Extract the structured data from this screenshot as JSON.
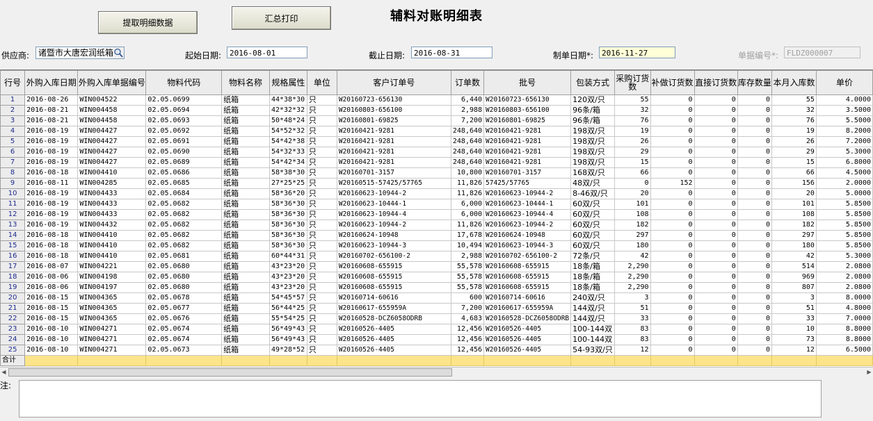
{
  "toolbar": {
    "fetch_label": "提取明细数据",
    "print_label": "汇总打印"
  },
  "title": "辅料对账明细表",
  "form": {
    "supplier_label": "供应商:",
    "supplier_value": "诸暨市大唐宏润纸箱",
    "start_label": "起始日期:",
    "start_value": "2016-08-01",
    "end_label": "截止日期:",
    "end_value": "2016-08-31",
    "created_label": "制单日期*:",
    "created_value": "2016-11-27",
    "docno_label": "单据编号*:",
    "docno_value": "FLDZ000007"
  },
  "grid": {
    "columns": [
      "行号",
      "外购入库日期",
      "外购入库单据编号",
      "物料代码",
      "物料名称",
      "规格属性",
      "单位",
      "客户订单号",
      "订单数",
      "批号",
      "包装方式",
      "采购订货数",
      "补做订货数",
      "直接订货数",
      "库存数量",
      "本月入库数",
      "单价"
    ],
    "rows": [
      [
        "1",
        "2016-08-26",
        "WIN004522",
        "02.05.0699",
        "纸箱",
        "44*38*30",
        "只",
        "W20160723-656130",
        "6,440",
        "W20160723-656130",
        "120双/只",
        "55",
        "0",
        "0",
        "0",
        "55",
        "4.0000"
      ],
      [
        "2",
        "2016-08-21",
        "WIN004458",
        "02.05.0694",
        "纸箱",
        "42*32*32",
        "只",
        "W20160803-656100",
        "2,988",
        "W20160803-656100",
        "96条/箱",
        "32",
        "0",
        "0",
        "0",
        "32",
        "3.5000"
      ],
      [
        "3",
        "2016-08-21",
        "WIN004458",
        "02.05.0693",
        "纸箱",
        "50*48*24",
        "只",
        "W20160801-69825",
        "7,200",
        "W20160801-69825",
        "96条/箱",
        "76",
        "0",
        "0",
        "0",
        "76",
        "5.5000"
      ],
      [
        "4",
        "2016-08-19",
        "WIN004427",
        "02.05.0692",
        "纸箱",
        "54*52*32",
        "只",
        "W20160421-9281",
        "248,640",
        "W20160421-9281",
        "198双/只",
        "19",
        "0",
        "0",
        "0",
        "19",
        "8.2000"
      ],
      [
        "5",
        "2016-08-19",
        "WIN004427",
        "02.05.0691",
        "纸箱",
        "54*42*38",
        "只",
        "W20160421-9281",
        "248,640",
        "W20160421-9281",
        "198双/只",
        "26",
        "0",
        "0",
        "0",
        "26",
        "7.2000"
      ],
      [
        "6",
        "2016-08-19",
        "WIN004427",
        "02.05.0690",
        "纸箱",
        "54*32*33",
        "只",
        "W20160421-9281",
        "248,640",
        "W20160421-9281",
        "198双/只",
        "29",
        "0",
        "0",
        "0",
        "29",
        "5.3000"
      ],
      [
        "7",
        "2016-08-19",
        "WIN004427",
        "02.05.0689",
        "纸箱",
        "54*42*34",
        "只",
        "W20160421-9281",
        "248,640",
        "W20160421-9281",
        "198双/只",
        "15",
        "0",
        "0",
        "0",
        "15",
        "6.8000"
      ],
      [
        "8",
        "2016-08-18",
        "WIN004410",
        "02.05.0686",
        "纸箱",
        "58*38*30",
        "只",
        "W20160701-3157",
        "10,800",
        "W20160701-3157",
        "168双/只",
        "66",
        "0",
        "0",
        "0",
        "66",
        "4.5000"
      ],
      [
        "9",
        "2016-08-11",
        "WIN004285",
        "02.05.0685",
        "纸箱",
        "27*25*25",
        "只",
        "W20160515-57425/57765",
        "11,826",
        "57425/57765",
        "48双/只",
        "0",
        "152",
        "0",
        "0",
        "156",
        "2.0000"
      ],
      [
        "10",
        "2016-08-19",
        "WIN004433",
        "02.05.0684",
        "纸箱",
        "58*36*20",
        "只",
        "W20160623-10944-2",
        "11,826",
        "W20160623-10944-2",
        "8-46双/只",
        "20",
        "0",
        "0",
        "0",
        "20",
        "5.0000"
      ],
      [
        "11",
        "2016-08-19",
        "WIN004433",
        "02.05.0682",
        "纸箱",
        "58*36*30",
        "只",
        "W20160623-10444-1",
        "6,000",
        "W20160623-10444-1",
        "60双/只",
        "101",
        "0",
        "0",
        "0",
        "101",
        "5.8500"
      ],
      [
        "12",
        "2016-08-19",
        "WIN004433",
        "02.05.0682",
        "纸箱",
        "58*36*30",
        "只",
        "W20160623-10944-4",
        "6,000",
        "W20160623-10944-4",
        "60双/只",
        "108",
        "0",
        "0",
        "0",
        "108",
        "5.8500"
      ],
      [
        "13",
        "2016-08-19",
        "WIN004432",
        "02.05.0682",
        "纸箱",
        "58*36*30",
        "只",
        "W20160623-10944-2",
        "11,826",
        "W20160623-10944-2",
        "60双/只",
        "182",
        "0",
        "0",
        "0",
        "182",
        "5.8500"
      ],
      [
        "14",
        "2016-08-18",
        "WIN004410",
        "02.05.0682",
        "纸箱",
        "58*36*30",
        "只",
        "W20160624-10948",
        "17,678",
        "W20160624-10948",
        "60双/只",
        "297",
        "0",
        "0",
        "0",
        "297",
        "5.8500"
      ],
      [
        "15",
        "2016-08-18",
        "WIN004410",
        "02.05.0682",
        "纸箱",
        "58*36*30",
        "只",
        "W20160623-10944-3",
        "10,494",
        "W20160623-10944-3",
        "60双/只",
        "180",
        "0",
        "0",
        "0",
        "180",
        "5.8500"
      ],
      [
        "16",
        "2016-08-18",
        "WIN004410",
        "02.05.0681",
        "纸箱",
        "60*44*31",
        "只",
        "W20160702-656100-2",
        "2,988",
        "W20160702-656100-2",
        "72条/只",
        "42",
        "0",
        "0",
        "0",
        "42",
        "5.3000"
      ],
      [
        "17",
        "2016-08-07",
        "WIN004221",
        "02.05.0680",
        "纸箱",
        "43*23*20",
        "只",
        "W20160608-655915",
        "55,578",
        "W20160608-655915",
        "18条/箱",
        "2,290",
        "0",
        "0",
        "0",
        "514",
        "2.0800"
      ],
      [
        "18",
        "2016-08-06",
        "WIN004198",
        "02.05.0680",
        "纸箱",
        "43*23*20",
        "只",
        "W20160608-655915",
        "55,578",
        "W20160608-655915",
        "18条/箱",
        "2,290",
        "0",
        "0",
        "0",
        "969",
        "2.0800"
      ],
      [
        "19",
        "2016-08-06",
        "WIN004197",
        "02.05.0680",
        "纸箱",
        "43*23*20",
        "只",
        "W20160608-655915",
        "55,578",
        "W20160608-655915",
        "18条/箱",
        "2,290",
        "0",
        "0",
        "0",
        "807",
        "2.0800"
      ],
      [
        "20",
        "2016-08-15",
        "WIN004365",
        "02.05.0678",
        "纸箱",
        "54*45*57",
        "只",
        "W20160714-60616",
        "600",
        "W20160714-60616",
        "240双/只",
        "3",
        "0",
        "0",
        "0",
        "3",
        "8.0000"
      ],
      [
        "21",
        "2016-08-15",
        "WIN004365",
        "02.05.0677",
        "纸箱",
        "56*44*25",
        "只",
        "W20160617-655959A",
        "7,200",
        "W20160617-655959A",
        "144双/只",
        "51",
        "0",
        "0",
        "0",
        "51",
        "4.8000"
      ],
      [
        "22",
        "2016-08-15",
        "WIN004365",
        "02.05.0676",
        "纸箱",
        "55*54*25",
        "只",
        "W20160528-DCZ6058ODRB",
        "4,683",
        "W20160528-DCZ6058ODRB",
        "144双/只",
        "33",
        "0",
        "0",
        "0",
        "33",
        "7.0000"
      ],
      [
        "23",
        "2016-08-10",
        "WIN004271",
        "02.05.0674",
        "纸箱",
        "56*49*43",
        "只",
        "W20160526-4405",
        "12,456",
        "W20160526-4405",
        "100-144双",
        "83",
        "0",
        "0",
        "0",
        "10",
        "8.8000"
      ],
      [
        "24",
        "2016-08-10",
        "WIN004271",
        "02.05.0674",
        "纸箱",
        "56*49*43",
        "只",
        "W20160526-4405",
        "12,456",
        "W20160526-4405",
        "100-144双",
        "83",
        "0",
        "0",
        "0",
        "73",
        "8.8000"
      ],
      [
        "25",
        "2016-08-10",
        "WIN004271",
        "02.05.0673",
        "纸箱",
        "49*28*52",
        "只",
        "W20160526-4405",
        "12,456",
        "W20160526-4405",
        "54-93双/只",
        "12",
        "0",
        "0",
        "0",
        "12",
        "6.5000"
      ]
    ],
    "total_label": "合计"
  },
  "notes": {
    "label": "注:"
  },
  "icons": {
    "supplier_lookup": "magnifier-icon",
    "scroll_left": "arrow-left-icon",
    "scroll_right": "arrow-right-icon"
  }
}
